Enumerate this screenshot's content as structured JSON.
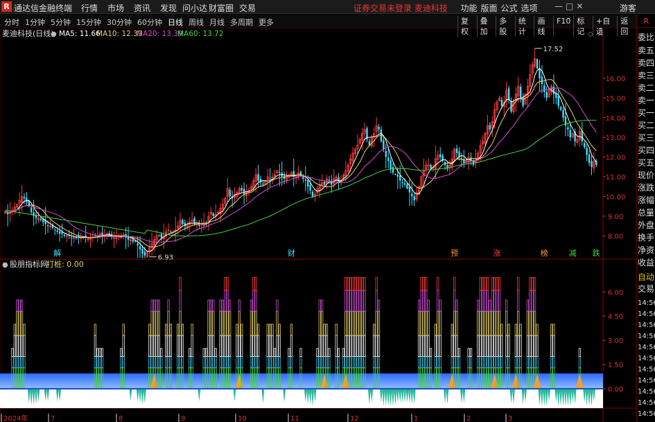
{
  "titlebar": {
    "logo": "R",
    "app_name": "通达信金融终端",
    "menu": [
      "行情",
      "市场",
      "资讯",
      "发现",
      "问小达",
      "财富圈",
      "交易"
    ],
    "notice": "证券交易未登录  麦迪科技",
    "right_menu": [
      "功能",
      "版面",
      "公式",
      "选项"
    ],
    "win": [
      "—",
      "□",
      "✕"
    ],
    "guest": "游客"
  },
  "toolbar": {
    "timeframes": [
      "分时",
      "1分钟",
      "5分钟",
      "15分钟",
      "30分钟",
      "60分钟",
      "日线",
      "周线",
      "月线",
      "多周期",
      "更多"
    ],
    "active_timeframe": "日线",
    "buttons": [
      "复权",
      "叠加",
      "多股",
      "统计",
      "画线",
      "F10",
      "标记",
      "+自选",
      "返回"
    ]
  },
  "right_panel": {
    "header": "R",
    "labels": [
      "委比",
      "卖五",
      "卖四",
      "卖三",
      "卖二",
      "卖一",
      "买一",
      "买二",
      "买三",
      "买四",
      "买五",
      "现价",
      "涨跌",
      "涨幅",
      "总量",
      "外盘",
      "换手",
      "净资",
      "收益",
      "自动",
      "交易"
    ],
    "times": [
      "14:56",
      "14:56",
      "14:56",
      "14:56",
      "14:56",
      "14:56",
      "14:56",
      "14:56",
      "14:56",
      "14:56",
      "14:56"
    ]
  },
  "colors": {
    "up": "#ff3c3c",
    "down": "#40e0ff",
    "ma5": "#ffffff",
    "ma10": "#e8d36a",
    "ma20": "#d24fd8",
    "ma60": "#46d246",
    "axis": "#e03030",
    "grid": "#8a0000",
    "price_label": "#e03030"
  },
  "main_header": {
    "name": "麦迪科技(日线)",
    "ma5": "MA5: 11.66",
    "ma10": "MA10: 12.39",
    "ma20": "MA20: 13.39",
    "ma60": "MA60: 13.72"
  },
  "chart_data": {
    "type": "candlestick",
    "price_axis_ticks": [
      8.0,
      9.0,
      10.0,
      11.0,
      12.0,
      13.0,
      14.0,
      15.0,
      16.0
    ],
    "price_range": [
      7.2,
      17.9
    ],
    "high_label": "17.52",
    "low_label": "6.93",
    "high_value": 17.52,
    "low_value": 6.93,
    "date_labels": [
      "2024年",
      "7",
      "8",
      "9",
      "10",
      "11",
      "12",
      "1",
      "2",
      "3"
    ],
    "markers": [
      {
        "text": "解",
        "color": "#40e0ff",
        "idx": 22
      },
      {
        "text": "财",
        "color": "#40e0ff",
        "idx": 121
      },
      {
        "text": "预",
        "color": "#ff9a3c",
        "idx": 190
      },
      {
        "text": "涨",
        "color": "#ff3c3c",
        "idx": 208
      },
      {
        "text": "榜",
        "color": "#ff9a3c",
        "idx": 228
      },
      {
        "text": "减",
        "color": "#46d246",
        "idx": 240
      },
      {
        "text": "跌",
        "color": "#46d246",
        "idx": 250
      }
    ],
    "close": [
      9.25,
      9.1,
      9.2,
      9.3,
      9.45,
      9.6,
      9.8,
      10.0,
      9.9,
      9.7,
      9.5,
      9.2,
      9.0,
      8.9,
      8.9,
      8.8,
      8.7,
      8.6,
      8.5,
      8.5,
      8.4,
      8.3,
      8.2,
      8.1,
      8.1,
      8.0,
      8.0,
      8.0,
      7.9,
      7.9,
      7.9,
      7.95,
      7.9,
      7.95,
      7.9,
      7.85,
      7.9,
      7.95,
      8.0,
      8.0,
      8.1,
      8.05,
      8.0,
      8.1,
      8.0,
      7.95,
      7.9,
      7.9,
      8.0,
      8.0,
      8.05,
      7.9,
      7.8,
      7.8,
      7.7,
      7.7,
      7.5,
      7.3,
      7.1,
      7.0,
      7.2,
      7.4,
      7.6,
      7.8,
      8.0,
      8.0,
      7.9,
      8.0,
      8.2,
      8.3,
      8.2,
      8.2,
      8.3,
      8.5,
      8.8,
      8.6,
      8.5,
      8.6,
      8.7,
      8.8,
      8.6,
      8.6,
      8.5,
      8.6,
      8.7,
      8.6,
      9.0,
      9.2,
      9.0,
      9.1,
      9.2,
      9.4,
      9.6,
      9.9,
      10.4,
      10.0,
      9.9,
      10.1,
      10.2,
      10.4,
      10.3,
      10.1,
      10.2,
      10.3,
      10.5,
      10.8,
      11.1,
      10.8,
      10.7,
      10.6,
      10.8,
      11.0,
      10.9,
      11.0,
      11.1,
      11.3,
      11.2,
      11.0,
      10.9,
      11.0,
      11.1,
      11.2,
      11.0,
      11.0,
      11.2,
      11.1,
      10.9,
      10.8,
      10.5,
      10.3,
      10.0,
      10.1,
      10.4,
      10.6,
      10.7,
      10.6,
      10.9,
      10.8,
      10.6,
      10.9,
      11.0,
      10.7,
      10.8,
      11.1,
      11.3,
      11.6,
      11.9,
      12.2,
      12.4,
      12.6,
      12.9,
      13.2,
      13.4,
      12.9,
      12.6,
      13.0,
      13.2,
      13.6,
      13.4,
      12.8,
      12.4,
      12.0,
      11.8,
      11.4,
      11.2,
      11.1,
      11.0,
      10.8,
      10.7,
      10.6,
      10.4,
      10.2,
      10.0,
      9.8,
      10.2,
      10.5,
      11.0,
      11.3,
      11.6,
      11.6,
      11.4,
      11.5,
      11.9,
      12.1,
      12.0,
      11.8,
      11.6,
      11.4,
      11.6,
      11.9,
      12.4,
      12.2,
      12.0,
      11.9,
      11.7,
      11.8,
      12.0,
      11.8,
      11.6,
      11.9,
      12.2,
      12.6,
      12.8,
      13.2,
      13.6,
      13.4,
      13.8,
      14.4,
      14.8,
      15.0,
      14.6,
      14.8,
      15.4,
      14.9,
      14.3,
      14.8,
      15.2,
      15.6,
      15.0,
      14.6,
      15.2,
      15.6,
      16.2,
      16.7,
      17.0,
      16.5,
      16.0,
      15.7,
      15.3,
      15.0,
      15.4,
      15.6,
      15.2,
      15.0,
      14.6,
      14.4,
      14.0,
      13.6,
      13.4,
      13.0,
      13.2,
      12.8,
      12.9,
      13.3,
      12.8,
      12.5,
      12.1,
      11.7,
      11.5,
      11.8,
      11.6
    ],
    "indicator": {
      "name": "股朋指标网",
      "label": "打桩: 0.00",
      "ticks": [
        0.0,
        1.5,
        3.0,
        4.5,
        6.0
      ],
      "range": [
        -1.2,
        7.3
      ]
    }
  }
}
